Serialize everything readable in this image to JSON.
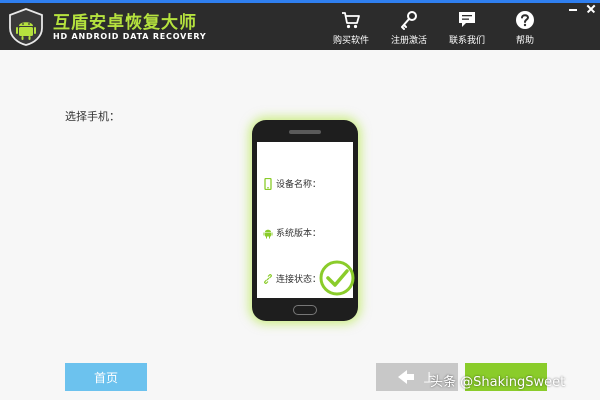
{
  "app": {
    "title": "互盾安卓恢复大师",
    "subtitle": "HD ANDROID DATA RECOVERY"
  },
  "nav": {
    "buy": "购买软件",
    "register": "注册激活",
    "contact": "联系我们",
    "help": "帮助"
  },
  "content": {
    "select_phone_label": "选择手机：",
    "device_name_label": "设备名称：",
    "system_version_label": "系统版本：",
    "connection_status_label": "连接状态："
  },
  "buttons": {
    "home": "首页",
    "prev": "上",
    "next": ""
  },
  "watermark": "头条 @ShakingSweet",
  "colors": {
    "header_bg": "#2c2c2c",
    "title_green": "#b5e23e",
    "accent_green": "#8acc2a",
    "home_blue": "#6cc2ee",
    "disabled_gray": "#c8c8c8"
  },
  "icons": {
    "logo": "android-shield-icon",
    "buy": "shopping-cart-icon",
    "register": "key-icon",
    "contact": "chat-icon",
    "help": "help-icon",
    "device": "phone-icon",
    "system": "android-icon",
    "connection": "link-icon",
    "status": "checkmark-circle-icon"
  }
}
